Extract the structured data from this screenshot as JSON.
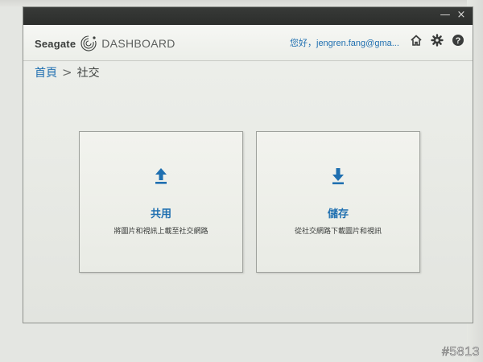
{
  "window": {
    "brand": "Seagate",
    "product": "DASHBOARD",
    "controls": {
      "minimize": "—",
      "close": "×"
    }
  },
  "header": {
    "greeting": "您好，jengren.fang@gma...",
    "icons": [
      "home-icon",
      "gear-icon",
      "help-icon"
    ]
  },
  "breadcrumb": {
    "home": "首頁",
    "separator": ">",
    "current": "社交"
  },
  "cards": [
    {
      "title": "共用",
      "description": "將圖片和視訊上載至社交網路",
      "icon": "upload-icon"
    },
    {
      "title": "儲存",
      "description": "從社交網路下載圖片和視訊",
      "icon": "download-icon"
    }
  ],
  "watermark": "#5813",
  "colors": {
    "accent": "#1f6fb0",
    "titlebar": "#2e302e",
    "background": "#e9ebe6"
  }
}
